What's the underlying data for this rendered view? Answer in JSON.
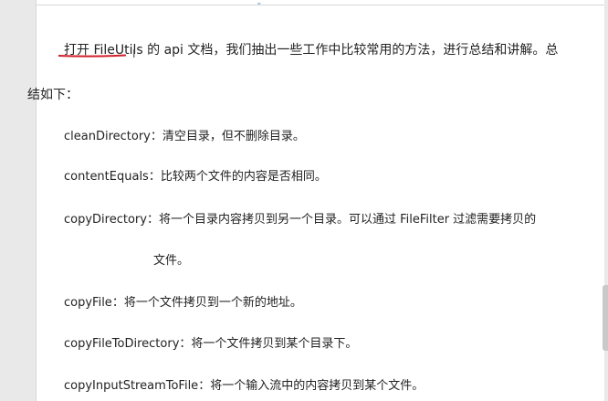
{
  "intro": {
    "line1": "打开 FileUtils 的 api 文档，我们抽出一些工作中比较常用的方法，进行总结和讲解。总",
    "line2": "结如下："
  },
  "methods": [
    {
      "name": "cleanDirectory",
      "desc": "：清空目录，但不删除目录。"
    },
    {
      "name": "contentEquals",
      "desc": "：比较两个文件的内容是否相同。"
    },
    {
      "name": "copyDirectory",
      "desc": "：将一个目录内容拷贝到另一个目录。可以通过 FileFilter 过滤需要拷贝的",
      "cont": "文件。"
    },
    {
      "name": "copyFile",
      "desc": "：将一个文件拷贝到一个新的地址。"
    },
    {
      "name": "copyFileToDirectory",
      "desc": "：将一个文件拷贝到某个目录下。"
    },
    {
      "name": "copyInputStreamToFile",
      "desc": "：将一个输入流中的内容拷贝到某个文件。"
    }
  ],
  "colors": {
    "underline": "#d0202a",
    "text": "#222222"
  }
}
